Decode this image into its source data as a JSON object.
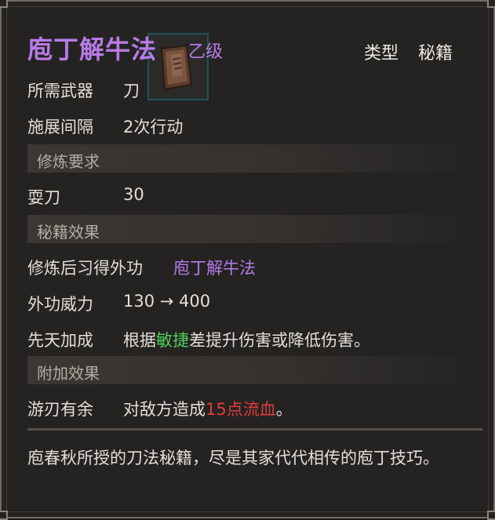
{
  "header": {
    "skill_name": "庖丁解牛法",
    "grade": "乙级",
    "type_label": "类型",
    "type_value": "秘籍"
  },
  "details": {
    "weapon_label": "所需武器",
    "weapon_value": "刀",
    "interval_label": "施展间隔",
    "interval_value": "2次行动"
  },
  "sections": {
    "requirements_title": "修炼要求",
    "effects_title": "秘籍效果",
    "extra_title": "附加效果"
  },
  "requirements": {
    "skill_label": "耍刀",
    "skill_value": "30"
  },
  "effects": {
    "learn_label": "修炼后习得外功",
    "learn_value": "庖丁解牛法",
    "power_label": "外功威力",
    "power_value": "130 → 400",
    "innate_label": "先天加成",
    "innate_prefix": "根据",
    "innate_attr": "敏捷",
    "innate_suffix": "差提升伤害或降低伤害。"
  },
  "extra": {
    "name_label": "游刃有余",
    "desc_prefix": "对敌方造成",
    "desc_highlight": "15点流血",
    "desc_suffix": "。"
  },
  "description": "庖春秋所授的刀法秘籍，尽是其家代代相传的庖丁技巧。",
  "colors": {
    "rarity_purple": "#b77be7",
    "attribute_green": "#4fcf5a",
    "bleed_red": "#e23b3b"
  },
  "icons": {
    "item": "scroll-book-icon"
  }
}
